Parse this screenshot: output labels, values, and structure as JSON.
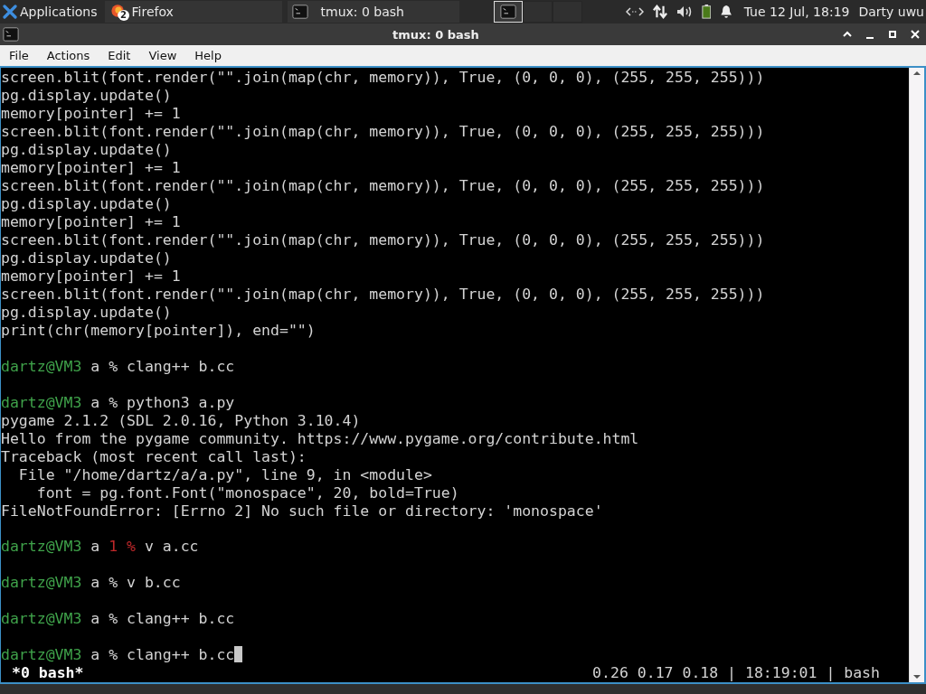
{
  "panel": {
    "apps_label": "Applications",
    "tasks": [
      {
        "kind": "firefox",
        "label": "Firefox",
        "badge": "2",
        "selected": false
      },
      {
        "kind": "terminal",
        "label": "tmux: 0 bash",
        "selected": false
      }
    ],
    "workspaces": [
      {
        "selected": true
      },
      {
        "selected": false
      },
      {
        "selected": false
      }
    ],
    "clock": "Tue 12 Jul, 18:19",
    "user": "Darty uwu"
  },
  "window": {
    "title": "tmux: 0 bash"
  },
  "menu": [
    "File",
    "Actions",
    "Edit",
    "View",
    "Help"
  ],
  "terminal": {
    "lines": [
      {
        "kind": "output",
        "text": "screen.blit(font.render(\"\".join(map(chr, memory)), True, (0, 0, 0), (255, 255, 255)))"
      },
      {
        "kind": "output",
        "text": "pg.display.update()"
      },
      {
        "kind": "output",
        "text": "memory[pointer] += 1"
      },
      {
        "kind": "output",
        "text": "screen.blit(font.render(\"\".join(map(chr, memory)), True, (0, 0, 0), (255, 255, 255)))"
      },
      {
        "kind": "output",
        "text": "pg.display.update()"
      },
      {
        "kind": "output",
        "text": "memory[pointer] += 1"
      },
      {
        "kind": "output",
        "text": "screen.blit(font.render(\"\".join(map(chr, memory)), True, (0, 0, 0), (255, 255, 255)))"
      },
      {
        "kind": "output",
        "text": "pg.display.update()"
      },
      {
        "kind": "output",
        "text": "memory[pointer] += 1"
      },
      {
        "kind": "output",
        "text": "screen.blit(font.render(\"\".join(map(chr, memory)), True, (0, 0, 0), (255, 255, 255)))"
      },
      {
        "kind": "output",
        "text": "pg.display.update()"
      },
      {
        "kind": "output",
        "text": "memory[pointer] += 1"
      },
      {
        "kind": "output",
        "text": "screen.blit(font.render(\"\".join(map(chr, memory)), True, (0, 0, 0), (255, 255, 255)))"
      },
      {
        "kind": "output",
        "text": "pg.display.update()"
      },
      {
        "kind": "output",
        "text": "print(chr(memory[pointer]), end=\"\")"
      },
      {
        "kind": "blank"
      },
      {
        "kind": "prompt",
        "user": "dartz@VM3",
        "dir": "a",
        "symbol": "%",
        "command": "clang++ b.cc"
      },
      {
        "kind": "blank"
      },
      {
        "kind": "prompt",
        "user": "dartz@VM3",
        "dir": "a",
        "symbol": "%",
        "command": "python3 a.py"
      },
      {
        "kind": "output",
        "text": "pygame 2.1.2 (SDL 2.0.16, Python 3.10.4)"
      },
      {
        "kind": "output",
        "text": "Hello from the pygame community. https://www.pygame.org/contribute.html"
      },
      {
        "kind": "output",
        "text": "Traceback (most recent call last):"
      },
      {
        "kind": "output",
        "text": "  File \"/home/dartz/a/a.py\", line 9, in <module>"
      },
      {
        "kind": "output",
        "text": "    font = pg.font.Font(\"monospace\", 20, bold=True)"
      },
      {
        "kind": "output",
        "text": "FileNotFoundError: [Errno 2] No such file or directory: 'monospace'"
      },
      {
        "kind": "blank"
      },
      {
        "kind": "prompt",
        "user": "dartz@VM3",
        "dir": "a",
        "status": "1",
        "symbol": "%",
        "command": "v a.cc"
      },
      {
        "kind": "blank"
      },
      {
        "kind": "prompt",
        "user": "dartz@VM3",
        "dir": "a",
        "symbol": "%",
        "command": "v b.cc"
      },
      {
        "kind": "blank"
      },
      {
        "kind": "prompt",
        "user": "dartz@VM3",
        "dir": "a",
        "symbol": "%",
        "command": "clang++ b.cc"
      },
      {
        "kind": "blank"
      },
      {
        "kind": "prompt",
        "user": "dartz@VM3",
        "dir": "a",
        "symbol": "%",
        "command": "clang++ b.cc",
        "cursor": true
      }
    ],
    "status_left": "*0 bash*",
    "status_right": "0.26 0.17 0.18 | 18:19:01 | bash"
  }
}
